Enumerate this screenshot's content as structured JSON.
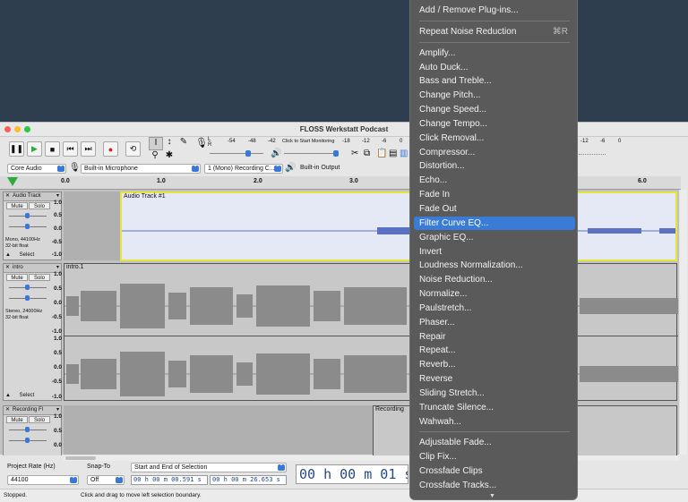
{
  "window": {
    "title": "FLOSS Werkstatt Podcast"
  },
  "meter": {
    "record_ticks": [
      "-54",
      "-48",
      "-42",
      "-18",
      "-12",
      "-6",
      "0"
    ],
    "click_to_monitor": "Click to Start Monitoring",
    "right_ticks": [
      "-12",
      "-6",
      "0"
    ]
  },
  "devices": {
    "host": "Core Audio",
    "input": "Built-in Microphone",
    "channels": "1 (Mono) Recording C...",
    "output": "Built-in Output"
  },
  "ruler": {
    "ticks": [
      "0.0",
      "1.0",
      "2.0",
      "3.0",
      "6.0"
    ]
  },
  "tracks": [
    {
      "name": "Audio Track",
      "clip_name": "Audio Track #1",
      "mute": "Mute",
      "solo": "Solo",
      "info1": "Mono, 44100Hz",
      "info2": "32-bit float",
      "select": "Select",
      "scale": [
        "1.0",
        "0.5",
        "0.0",
        "-0.5",
        "-1.0"
      ]
    },
    {
      "name": "intro",
      "clip_name": "intro.1",
      "mute": "Mute",
      "solo": "Solo",
      "info1": "Stereo, 24000Hz",
      "info2": "32-bit float",
      "select": "Select",
      "scale": [
        "1.0",
        "0.5",
        "0.0",
        "-0.5",
        "-1.0",
        "1.0",
        "0.5",
        "0.0",
        "-0.5",
        "-1.0"
      ]
    },
    {
      "name": "Recording Fl",
      "clip_name": "Recording",
      "mute": "Mute",
      "solo": "Solo",
      "scale": [
        "1.0",
        "0.5",
        "0.0"
      ]
    }
  ],
  "bottom": {
    "project_rate_label": "Project Rate (Hz)",
    "project_rate": "44100",
    "snap_to_label": "Snap-To",
    "snap_to": "Off",
    "selection_mode": "Start and End of Selection",
    "start_time": "00 h 00 m 00.591 s",
    "end_time": "00 h 00 m 26.653 s",
    "big_time": "00 h 00 m 01 s"
  },
  "status": {
    "left": "Stopped.",
    "hint": "Click and drag to move left selection boundary."
  },
  "menu": {
    "items": [
      {
        "label": "Add / Remove Plug-ins...",
        "shortcut": ""
      },
      {
        "label": "Repeat Noise Reduction",
        "shortcut": "⌘R"
      },
      {
        "label": "Amplify...",
        "shortcut": ""
      },
      {
        "label": "Auto Duck...",
        "shortcut": ""
      },
      {
        "label": "Bass and Treble...",
        "shortcut": ""
      },
      {
        "label": "Change Pitch...",
        "shortcut": ""
      },
      {
        "label": "Change Speed...",
        "shortcut": ""
      },
      {
        "label": "Change Tempo...",
        "shortcut": ""
      },
      {
        "label": "Click Removal...",
        "shortcut": ""
      },
      {
        "label": "Compressor...",
        "shortcut": ""
      },
      {
        "label": "Distortion...",
        "shortcut": ""
      },
      {
        "label": "Echo...",
        "shortcut": ""
      },
      {
        "label": "Fade In",
        "shortcut": ""
      },
      {
        "label": "Fade Out",
        "shortcut": ""
      },
      {
        "label": "Filter Curve EQ...",
        "shortcut": ""
      },
      {
        "label": "Graphic EQ...",
        "shortcut": ""
      },
      {
        "label": "Invert",
        "shortcut": ""
      },
      {
        "label": "Loudness Normalization...",
        "shortcut": ""
      },
      {
        "label": "Noise Reduction...",
        "shortcut": ""
      },
      {
        "label": "Normalize...",
        "shortcut": ""
      },
      {
        "label": "Paulstretch...",
        "shortcut": ""
      },
      {
        "label": "Phaser...",
        "shortcut": ""
      },
      {
        "label": "Repair",
        "shortcut": ""
      },
      {
        "label": "Repeat...",
        "shortcut": ""
      },
      {
        "label": "Reverb...",
        "shortcut": ""
      },
      {
        "label": "Reverse",
        "shortcut": ""
      },
      {
        "label": "Sliding Stretch...",
        "shortcut": ""
      },
      {
        "label": "Truncate Silence...",
        "shortcut": ""
      },
      {
        "label": "Wahwah...",
        "shortcut": ""
      },
      {
        "label": "Adjustable Fade...",
        "shortcut": ""
      },
      {
        "label": "Clip Fix...",
        "shortcut": ""
      },
      {
        "label": "Crossfade Clips",
        "shortcut": ""
      },
      {
        "label": "Crossfade Tracks...",
        "shortcut": ""
      }
    ],
    "highlighted": "Filter Curve EQ..."
  },
  "colors": {
    "desktop": "#2f3e4f",
    "menu_bg": "#5a5a5a",
    "menu_highlight": "#3a7bd5",
    "wave_selected": "#5b72c4",
    "wave_gray": "#8b8b8b",
    "selected_bg": "#e5e9f5"
  }
}
